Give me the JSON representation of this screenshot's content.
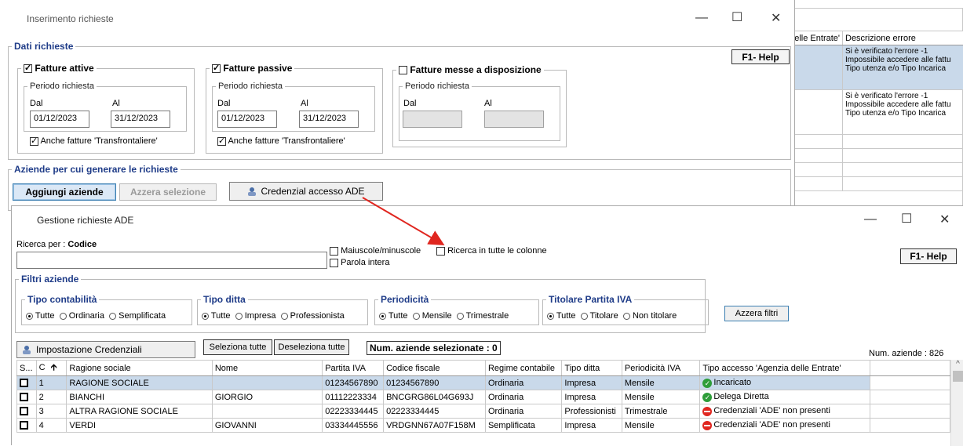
{
  "bg_window": {
    "col_prev": "elle Entrate'",
    "col_desc": "Descrizione errore",
    "rows": [
      [
        "Si è verificato l'errore -1",
        "Impossibile accedere alle fattu",
        "Tipo utenza e/o Tipo Incarica"
      ],
      [
        "Si è verificato l'errore -1",
        "Impossibile accedere alle fattu",
        "Tipo utenza e/o Tipo Incarica"
      ]
    ]
  },
  "win1": {
    "title": "Inserimento richieste",
    "ctrl_min": "—",
    "ctrl_max": "☐",
    "ctrl_close": "✕",
    "help": "F1- Help",
    "dati_legend": "Dati richieste",
    "attive": {
      "label": "Fatture attive",
      "periodo": "Periodo richiesta",
      "dal_label": "Dal",
      "al_label": "Al",
      "dal": "01/12/2023",
      "al": "31/12/2023",
      "transfr": "Anche fatture 'Transfrontaliere'"
    },
    "passive": {
      "label": "Fatture passive",
      "periodo": "Periodo richiesta",
      "dal_label": "Dal",
      "al_label": "Al",
      "dal": "01/12/2023",
      "al": "31/12/2023",
      "transfr": "Anche fatture 'Transfrontaliere'"
    },
    "messe": {
      "label": "Fatture messe a disposizione",
      "periodo": "Periodo richiesta",
      "dal_label": "Dal",
      "al_label": "Al"
    },
    "aziende_legend": "Aziende per cui generare le richieste",
    "btn_aggiungi": "Aggiungi aziende",
    "btn_azzera": "Azzera selezione",
    "btn_credenziali": "Credenzial accesso ADE"
  },
  "win2": {
    "title": "Gestione richieste ADE",
    "ctrl_min": "—",
    "ctrl_max": "☐",
    "ctrl_close": "✕",
    "help": "F1- Help",
    "ricerca_label": "Ricerca per :",
    "ricerca_field": "Codice",
    "search_value": "",
    "opt_maiuscole": "Maiuscole/minuscole",
    "opt_tutte_colonne": "Ricerca in tutte le colonne",
    "opt_parola": "Parola intera",
    "filtri_legend": "Filtri aziende",
    "contabilita": {
      "legend": "Tipo contabilità",
      "options": [
        "Tutte",
        "Ordinaria",
        "Semplificata"
      ]
    },
    "ditta": {
      "legend": "Tipo ditta",
      "options": [
        "Tutte",
        "Impresa",
        "Professionista"
      ]
    },
    "periodicita": {
      "legend": "Periodicità",
      "options": [
        "Tutte",
        "Mensile",
        "Trimestrale"
      ]
    },
    "titolare": {
      "legend": "Titolare Partita IVA",
      "options": [
        "Tutte",
        "Titolare",
        "Non titolare"
      ]
    },
    "btn_azzera_filtri": "Azzera filtri",
    "btn_impostazione": "Impostazione Credenziali",
    "btn_sel_tutte": "Seleziona tutte",
    "btn_desel_tutte": "Deseleziona tutte",
    "num_selezionate": "Num. aziende selezionate : 0",
    "num_aziende": "Num. aziende : 826",
    "columns": [
      "S...",
      "C",
      "Ragione sociale",
      "Nome",
      "Partita IVA",
      "Codice fiscale",
      "Regime contabile",
      "Tipo ditta",
      "Periodicità IVA",
      "Tipo accesso 'Agenzia delle Entrate'"
    ],
    "rows": [
      {
        "c": "1",
        "ragione": "RAGIONE SOCIALE",
        "nome": "",
        "piva": "01234567890",
        "cf": "01234567890",
        "regime": "Ordinaria",
        "ditta": "Impresa",
        "period": "Mensile",
        "accesso": "Incaricato",
        "status": "ok"
      },
      {
        "c": "2",
        "ragione": "BIANCHI",
        "nome": "GIORGIO",
        "piva": "01112223334",
        "cf": "BNCGRG86L04G693J",
        "regime": "Ordinaria",
        "ditta": "Impresa",
        "period": "Mensile",
        "accesso": "Delega Diretta",
        "status": "ok"
      },
      {
        "c": "3",
        "ragione": "ALTRA RAGIONE SOCIALE",
        "nome": "",
        "piva": "02223334445",
        "cf": "02223334445",
        "regime": "Ordinaria",
        "ditta": "Professionisti",
        "period": "Trimestrale",
        "accesso": "Credenziali 'ADE' non presenti",
        "status": "no"
      },
      {
        "c": "4",
        "ragione": "VERDI",
        "nome": "GIOVANNI",
        "piva": "03334445556",
        "cf": "VRDGNN67A07F158M",
        "regime": "Semplificata",
        "ditta": "Impresa",
        "period": "Mensile",
        "accesso": "Credenziali 'ADE' non presenti",
        "status": "no"
      }
    ]
  },
  "colors": {
    "accent_blue": "#1f3c88",
    "selected_row": "#c9d9ea",
    "arrow_red": "#e0261f",
    "ok_green": "#2e9d3a"
  }
}
